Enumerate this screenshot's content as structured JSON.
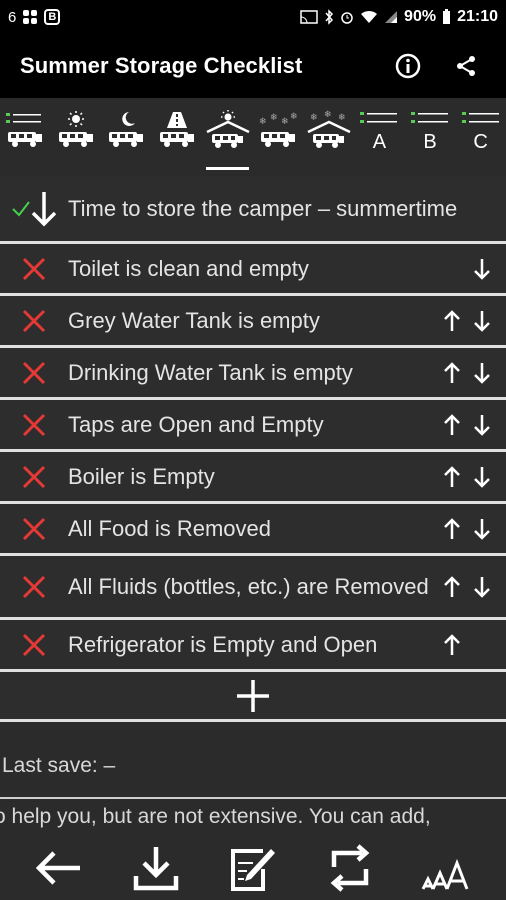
{
  "status_bar": {
    "left_glyph": "6",
    "left_badge": "B",
    "battery": "90%",
    "time": "21:10"
  },
  "app_bar": {
    "title": "Summer Storage Checklist",
    "info_icon": "info-icon",
    "share_icon": "share-icon"
  },
  "tabs": [
    {
      "icon": "list-camper-icon",
      "label": ""
    },
    {
      "icon": "sun-camper-icon",
      "label": ""
    },
    {
      "icon": "moon-camper-icon",
      "label": ""
    },
    {
      "icon": "road-camper-icon",
      "label": ""
    },
    {
      "icon": "sun-garage-icon",
      "label": "",
      "selected": true
    },
    {
      "icon": "snow-camper-icon",
      "label": ""
    },
    {
      "icon": "snow-garage-icon",
      "label": ""
    },
    {
      "icon": "list-a-icon",
      "label": "A"
    },
    {
      "icon": "list-b-icon",
      "label": "B"
    },
    {
      "icon": "list-c-icon",
      "label": "C"
    }
  ],
  "checklist": {
    "header": {
      "text": "Time to store the camper – summertime"
    },
    "items": [
      {
        "text": "Toilet is clean and empty",
        "checked": false,
        "up": false,
        "down": true
      },
      {
        "text": "Grey Water Tank is empty",
        "checked": false,
        "up": true,
        "down": true
      },
      {
        "text": "Drinking Water Tank is empty",
        "checked": false,
        "up": true,
        "down": true
      },
      {
        "text": "Taps are Open and Empty",
        "checked": false,
        "up": true,
        "down": true
      },
      {
        "text": "Boiler is Empty",
        "checked": false,
        "up": true,
        "down": true
      },
      {
        "text": "All Food is Removed",
        "checked": false,
        "up": true,
        "down": true
      },
      {
        "text": "All Fluids (bottles, etc.) are Removed",
        "checked": false,
        "up": true,
        "down": true,
        "tall": true
      },
      {
        "text": "Refrigerator is Empty and Open",
        "checked": false,
        "up": true,
        "down": false
      }
    ],
    "add_label": "+"
  },
  "last_save": "Last save: –",
  "hint_text": "o help you, but are not extensive. You can add,",
  "bottom_bar": [
    "back-arrow-icon",
    "download-icon",
    "edit-icon",
    "sync-icon",
    "text-size-icon"
  ],
  "colors": {
    "cross": "#e53935",
    "check": "#43d14b",
    "background": "#2b2b2b",
    "divider": "#e0e0e0"
  }
}
